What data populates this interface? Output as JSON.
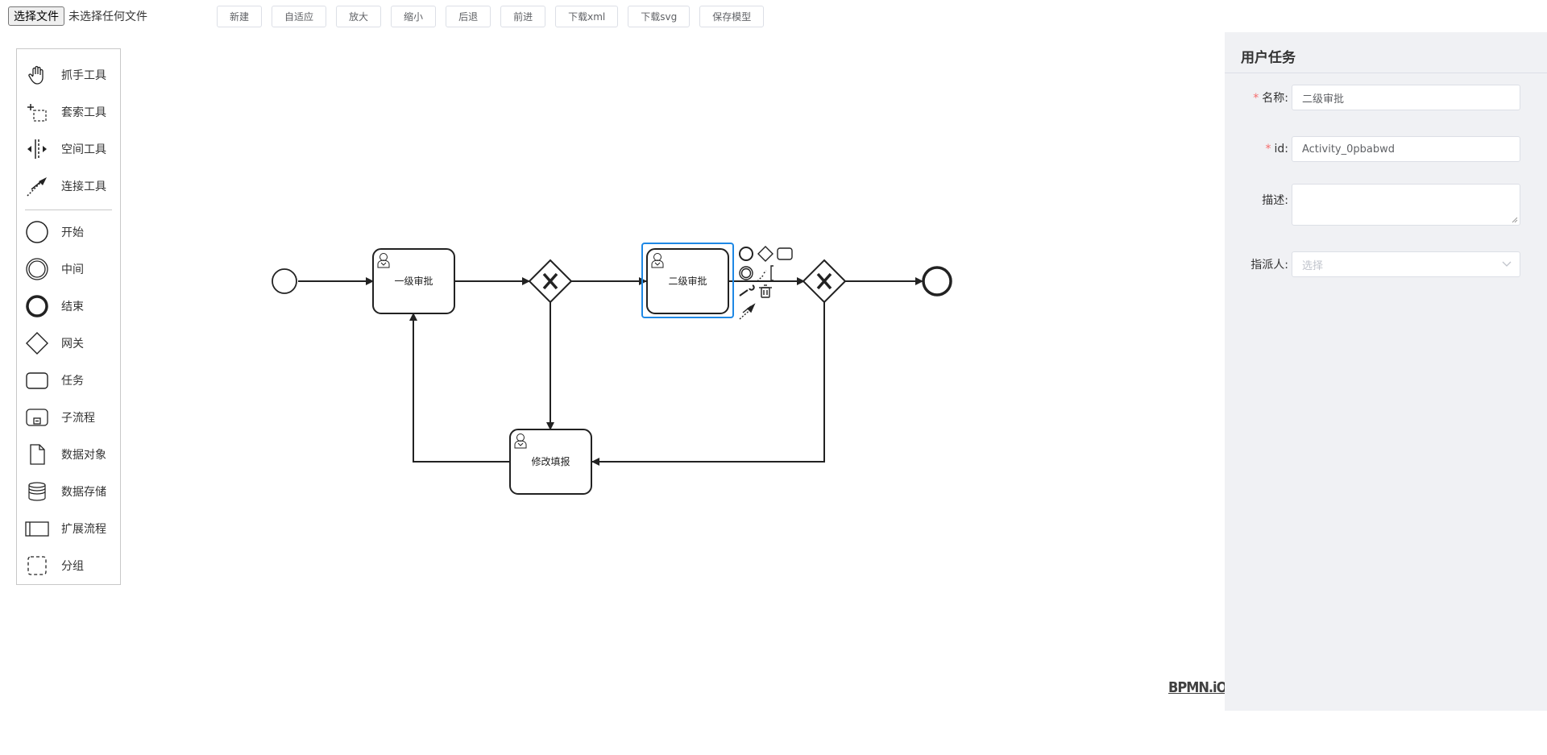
{
  "file_input": {
    "button_label": "选择文件",
    "status": "未选择任何文件"
  },
  "toolbar": {
    "buttons": [
      "新建",
      "自适应",
      "放大",
      "缩小",
      "后退",
      "前进",
      "下载xml",
      "下载svg",
      "保存模型"
    ]
  },
  "palette": {
    "tools": [
      {
        "label": "抓手工具",
        "icon": "hand-icon"
      },
      {
        "label": "套索工具",
        "icon": "lasso-icon"
      },
      {
        "label": "空间工具",
        "icon": "space-icon"
      },
      {
        "label": "连接工具",
        "icon": "connect-icon"
      }
    ],
    "elements": [
      {
        "label": "开始",
        "icon": "start-event-icon"
      },
      {
        "label": "中间",
        "icon": "intermediate-event-icon"
      },
      {
        "label": "结束",
        "icon": "end-event-icon"
      },
      {
        "label": "网关",
        "icon": "gateway-icon"
      },
      {
        "label": "任务",
        "icon": "task-icon"
      },
      {
        "label": "子流程",
        "icon": "subprocess-icon"
      },
      {
        "label": "数据对象",
        "icon": "data-object-icon"
      },
      {
        "label": "数据存储",
        "icon": "data-store-icon"
      },
      {
        "label": "扩展流程",
        "icon": "participant-icon"
      },
      {
        "label": "分组",
        "icon": "group-icon"
      }
    ]
  },
  "diagram": {
    "tasks": {
      "first": "一级审批",
      "second": "二级审批",
      "modify": "修改填报"
    },
    "selected_color": "#1e88e5",
    "logo": "BPMN.iO"
  },
  "properties": {
    "title": "用户任务",
    "name_label": "名称:",
    "name_value": "二级审批",
    "id_label": "id:",
    "id_value": "Activity_0pbabwd",
    "desc_label": "描述:",
    "desc_value": "",
    "assignee_label": "指派人:",
    "assignee_placeholder": "选择",
    "required_mark": "*"
  }
}
